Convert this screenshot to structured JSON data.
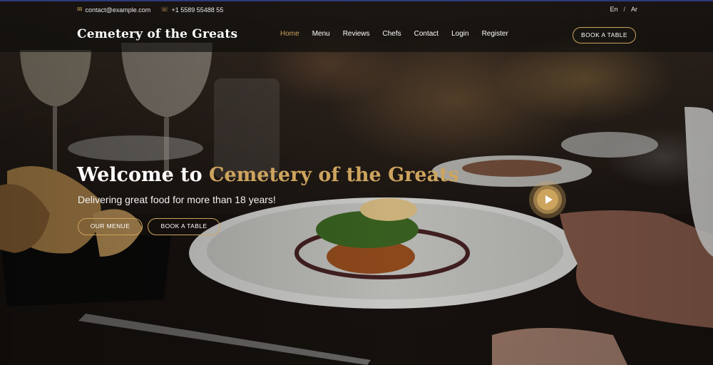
{
  "topbar": {
    "email": "contact@example.com",
    "phone": "+1 5589 55488 55",
    "email_icon": "envelope-icon",
    "phone_icon": "phone-icon",
    "languages": [
      "En",
      "Ar"
    ],
    "lang_separator": "/"
  },
  "header": {
    "logo": "Cemetery of the Greats",
    "nav": [
      "Home",
      "Menu",
      "Reviews",
      "Chefs",
      "Contact",
      "Login",
      "Register"
    ],
    "active_nav": "Home",
    "cta": "BOOK A TABLE"
  },
  "hero": {
    "title_prefix": "Welcome to ",
    "title_accent": "Cemetery of the Greats",
    "subtitle": "Delivering great food for more than 18 years!",
    "btn_menu": "OUR MENUE",
    "btn_book": "BOOK A TABLE",
    "play_icon": "play-icon"
  },
  "colors": {
    "accent": "#cda45e",
    "topbar_border": "#2f3a7a"
  }
}
